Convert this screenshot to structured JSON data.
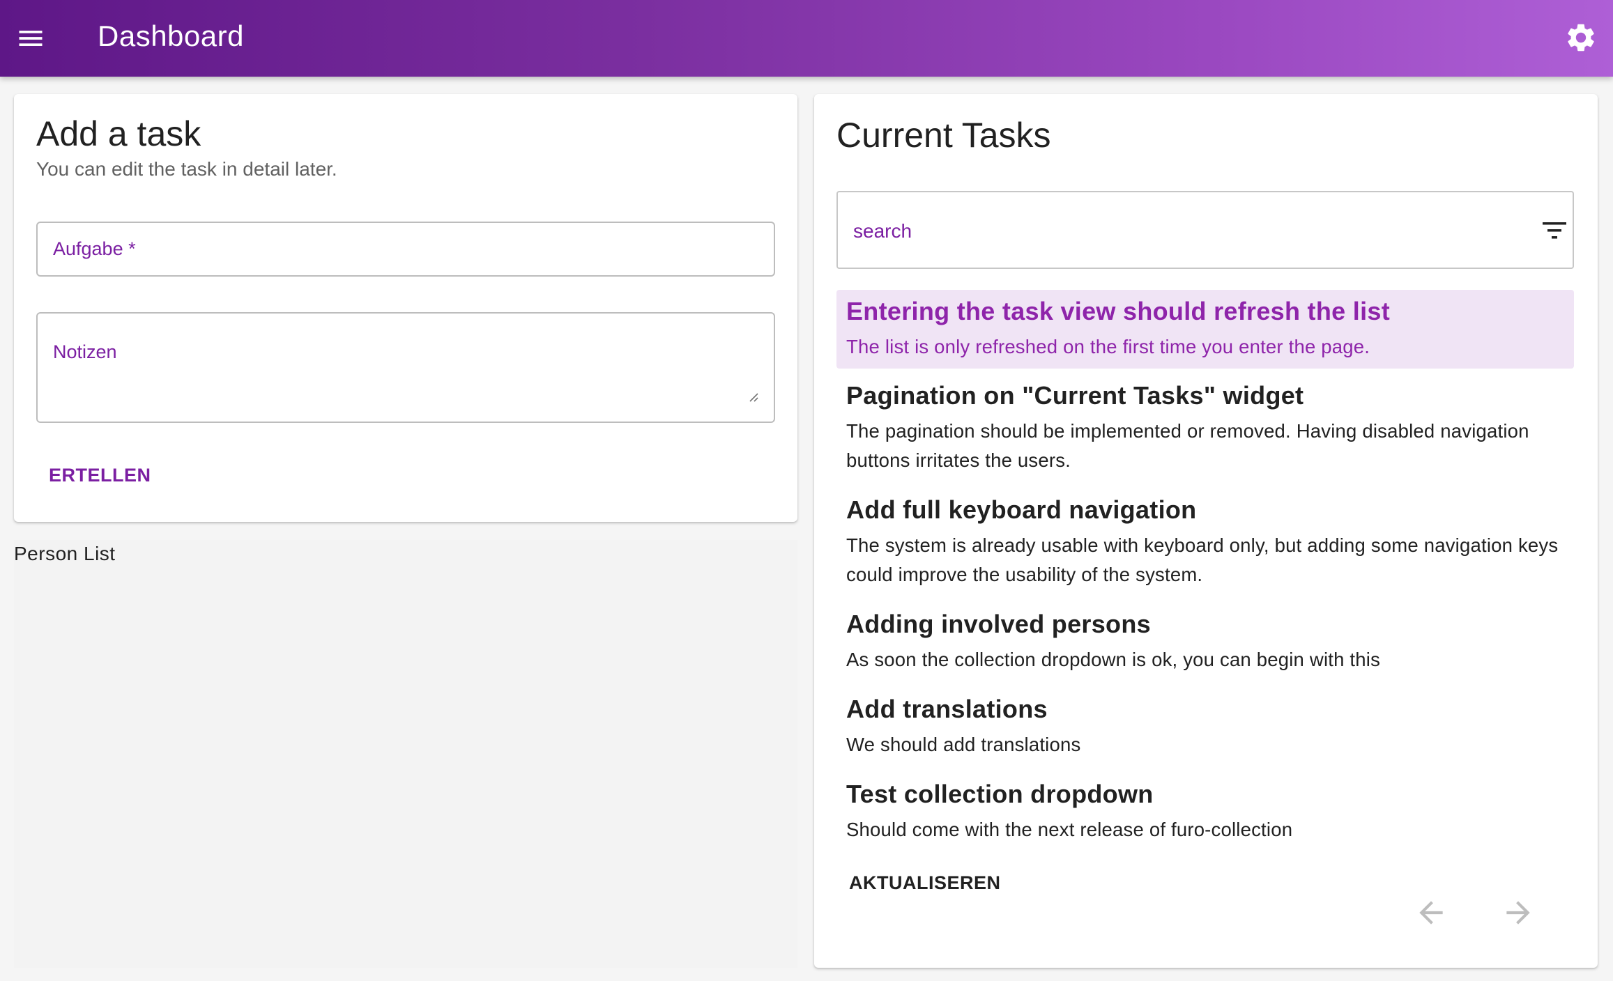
{
  "app_bar": {
    "title": "Dashboard",
    "menu_icon": "menu-icon",
    "settings_icon": "gear-icon"
  },
  "add_task": {
    "title": "Add a task",
    "subtitle": "You can edit the task in detail later.",
    "task_field_label": "Aufgabe *",
    "notes_field_label": "Notizen",
    "create_label": "ERTELLEN"
  },
  "person_list": {
    "title": "Person List"
  },
  "current_tasks": {
    "title": "Current Tasks",
    "search_placeholder": "search",
    "filter_icon": "filter-icon",
    "items": [
      {
        "title": "Entering the task view should refresh the list",
        "description": "The list is only refreshed on the first time you enter the page.",
        "selected": true
      },
      {
        "title": "Pagination on \"Current Tasks\" widget",
        "description": "The pagination should be implemented or removed. Having disabled navigation buttons irritates the users."
      },
      {
        "title": "Add full keyboard navigation",
        "description": "The system is already usable with keyboard only, but adding some navigation keys could improve the usability of the system."
      },
      {
        "title": "Adding involved persons",
        "description": "As soon the collection dropdown is ok, you can begin with this"
      },
      {
        "title": "Add translations",
        "description": "We should add translations"
      },
      {
        "title": "Test collection dropdown",
        "description": "Should come with the next release of furo-collection"
      }
    ],
    "refresh_label": "AKTUALISEREN",
    "prev_icon": "arrow-left-icon",
    "next_icon": "arrow-right-icon"
  },
  "colors": {
    "primary": "#7b1fa2",
    "selected_bg": "#f0e4f5",
    "app_bar_start": "#5e1787",
    "app_bar_end": "#ae5fd6"
  }
}
